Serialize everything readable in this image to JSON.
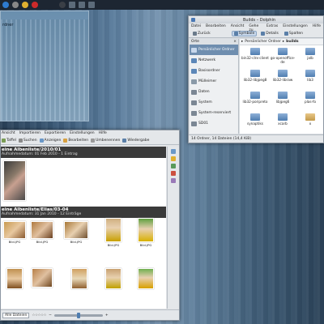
{
  "top_panel": {
    "icons": [
      "kde-menu-icon",
      "app-icon",
      "app-icon",
      "app-icon",
      "app-icon",
      "app-icon",
      "app-icon",
      "app-icon"
    ]
  },
  "left_pane": {
    "title": "rdner"
  },
  "dolphin": {
    "title": "Builds – Dolphin",
    "menu": [
      "Datei",
      "Bearbeiten",
      "Ansicht",
      "Gehe zu",
      "Extras",
      "Einstellungen",
      "Hilfe"
    ],
    "toolbar": [
      "Zurück",
      "Symbole",
      "Details",
      "Spalten"
    ],
    "places_header": "Orte",
    "places": [
      {
        "label": "Persönlicher Ordner",
        "selected": true
      },
      {
        "label": "Netzwerk",
        "selected": false
      },
      {
        "label": "Basisordner",
        "selected": false
      },
      {
        "label": "Mülleimer",
        "selected": false
      },
      {
        "label": "Daten",
        "selected": false
      },
      {
        "label": "System",
        "selected": false
      },
      {
        "label": "System-reserviert",
        "selected": false
      },
      {
        "label": "SD01",
        "selected": false
      }
    ],
    "breadcrumb": [
      "Persönlicher Ordner",
      "builds"
    ],
    "folders": [
      "bin32-clrx-client",
      "go-openoffice-de",
      "jalb",
      "lib32-libjpeg8",
      "lib32-libraw",
      "lib3",
      "lib32-poripreto",
      "libjpeg6",
      "plas-fo",
      "synaptiks",
      "xcarb",
      "x"
    ],
    "status": "14 Ordner, 14 Dateien (14,4 KiB)"
  },
  "digikam": {
    "menu": [
      "Ansicht",
      "Importieren",
      "Exportieren",
      "Einstellungen",
      "Hilfe"
    ],
    "toolbar": [
      "Taffel",
      "Suchen",
      "Anzeigen",
      "Bearbeiten",
      "Umbenennen",
      "Wiedergabe"
    ],
    "albums": [
      {
        "name": "eine Albenliste/2010/01",
        "date": "Aufnahmedatum: 01 Feb 2010 - 1 Eintrag"
      },
      {
        "name": "eine Albenliste/Elias/03-04",
        "date": "Aufnahmedatum: 31 Jan 2010 - 12 Einträge"
      }
    ],
    "thumb_caption": "Bild.JPG",
    "status": {
      "select": "Alle Dateien",
      "stars": "☆☆☆☆☆"
    }
  },
  "colors": {
    "accent": "#4f7db0",
    "album_header": "#3a3a3a",
    "selection": "#6f8eaf"
  }
}
